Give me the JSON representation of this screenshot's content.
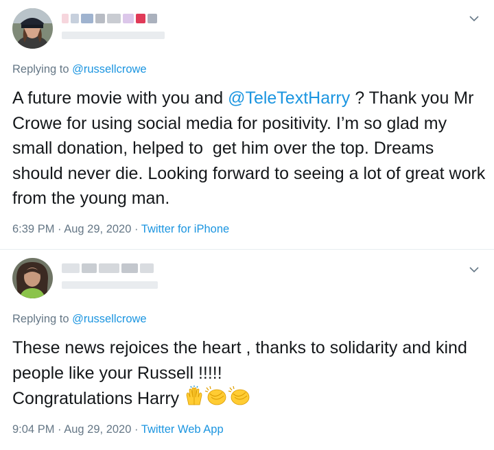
{
  "tweets": [
    {
      "replying_prefix": "Replying to ",
      "replying_handle": "@russellcrowe",
      "text_before": "A future movie with you and ",
      "mention": "@TeleTextHarry",
      "text_after": " ? Thank you Mr Crowe for using social media for positivity. I’m so glad my small donation, helped to  get him over the top. Dreams should never die. Looking forward to seeing a lot of great work from the young man.",
      "time": "6:39 PM",
      "date": "Aug 29, 2020",
      "source": "Twitter for iPhone",
      "separator": "·"
    },
    {
      "replying_prefix": "Replying to ",
      "replying_handle": "@russellcrowe",
      "text_line1": "These news rejoices the heart , thanks to solidarity and kind people like your Russell !!!!!",
      "text_line2": "Congratulations Harry ",
      "time": "9:04 PM",
      "date": "Aug 29, 2020",
      "source": "Twitter Web App",
      "separator": "·"
    }
  ],
  "icons": {
    "caret": "chevron-down-icon",
    "emoji": [
      "raising-hands-icon",
      "clapping-hands-icon",
      "clapping-hands-icon"
    ]
  },
  "colors": {
    "link": "#1b95e0",
    "secondary": "#657786",
    "text": "#14171a",
    "divider": "#e6ecf0"
  }
}
